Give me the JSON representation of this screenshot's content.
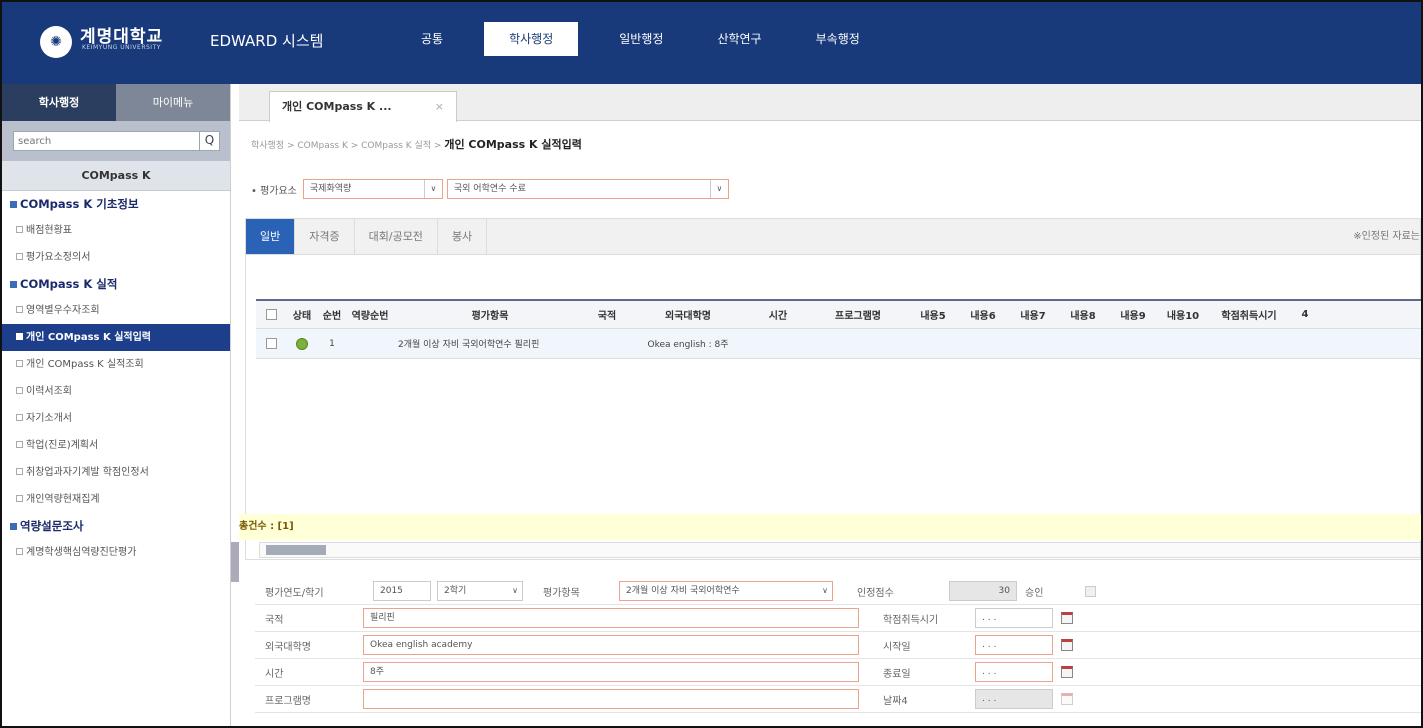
{
  "header": {
    "logo_glyph": "✺",
    "uni_name": "계명대학교",
    "uni_sub": "KEIMYUNG UNIVERSITY",
    "system_name": "EDWARD 시스템",
    "nav": [
      "공통",
      "학사행정",
      "일반행정",
      "산학연구",
      "부속행정"
    ],
    "nav_active": "학사행정"
  },
  "sidebar": {
    "tabs": [
      "학사행정",
      "마이메뉴"
    ],
    "search_placeholder": "search",
    "search_icon": "Q",
    "section_title": "COMpass K",
    "groups": [
      {
        "title": "COMpass K 기초정보",
        "items": [
          "배점현황표",
          "평가요소정의서"
        ]
      },
      {
        "title": "COMpass K 실적",
        "items": [
          "영역별우수자조회",
          "개인 COMpass K 실적입력",
          "개인 COMpass K 실적조회",
          "이력서조회",
          "자기소개서",
          "학업(진로)계획서",
          "취창업과자기계발 학점인정서",
          "개인역량현재집계"
        ]
      },
      {
        "title": "역량설문조사",
        "items": [
          "계명학생핵심역량진단평가"
        ]
      }
    ],
    "active_item": "개인 COMpass K 실적입력"
  },
  "main": {
    "doc_tab": "개인 COMpass K ...",
    "doc_tab_close": "×",
    "breadcrumb": "학사행정 > COMpass K > COMpass K 실적 >",
    "breadcrumb_current": "개인 COMpass K 실적입력",
    "filter": {
      "label": "• 평가요소",
      "select1": "국제화역량",
      "select2": "국외 어학연수 수료",
      "arrow": "∨"
    },
    "panel_tabs": [
      "일반",
      "자격증",
      "대회/공모전",
      "봉사"
    ],
    "panel_note": "※인정된 자료는",
    "grid": {
      "columns": [
        "상태",
        "순번",
        "역량순번",
        "평가항목",
        "국적",
        "외국대학명",
        "시간",
        "프로그램명",
        "내용5",
        "내용6",
        "내용7",
        "내용8",
        "내용9",
        "내용10",
        "학점취득시기",
        "4"
      ],
      "rows": [
        {
          "seq": "1",
          "item": "2개월 이상 자비 국외어학연수 필리핀",
          "country": "",
          "school": "Okea english : 8주",
          "time": ""
        }
      ]
    },
    "total": "총건수 : [1]",
    "form": {
      "eval_year_label": "평가연도/학기",
      "year": "2015",
      "term": "2학기",
      "item_label": "평가항목",
      "item_value": "2개월 이상 자비 국외어학연수",
      "score_label": "인정점수",
      "score": "30",
      "approve_label": "승인",
      "country_label": "국적",
      "country": "필리핀",
      "credit_time_label": "학점취득시기",
      "school_label": "외국대학명",
      "school": "Okea english academy",
      "start_label": "시작일",
      "time_label": "시간",
      "time": "8주",
      "end_label": "종료일",
      "program_label": "프로그램명",
      "program": "",
      "date4_label": "날짜4",
      "date_placeholder": ". . ."
    }
  }
}
